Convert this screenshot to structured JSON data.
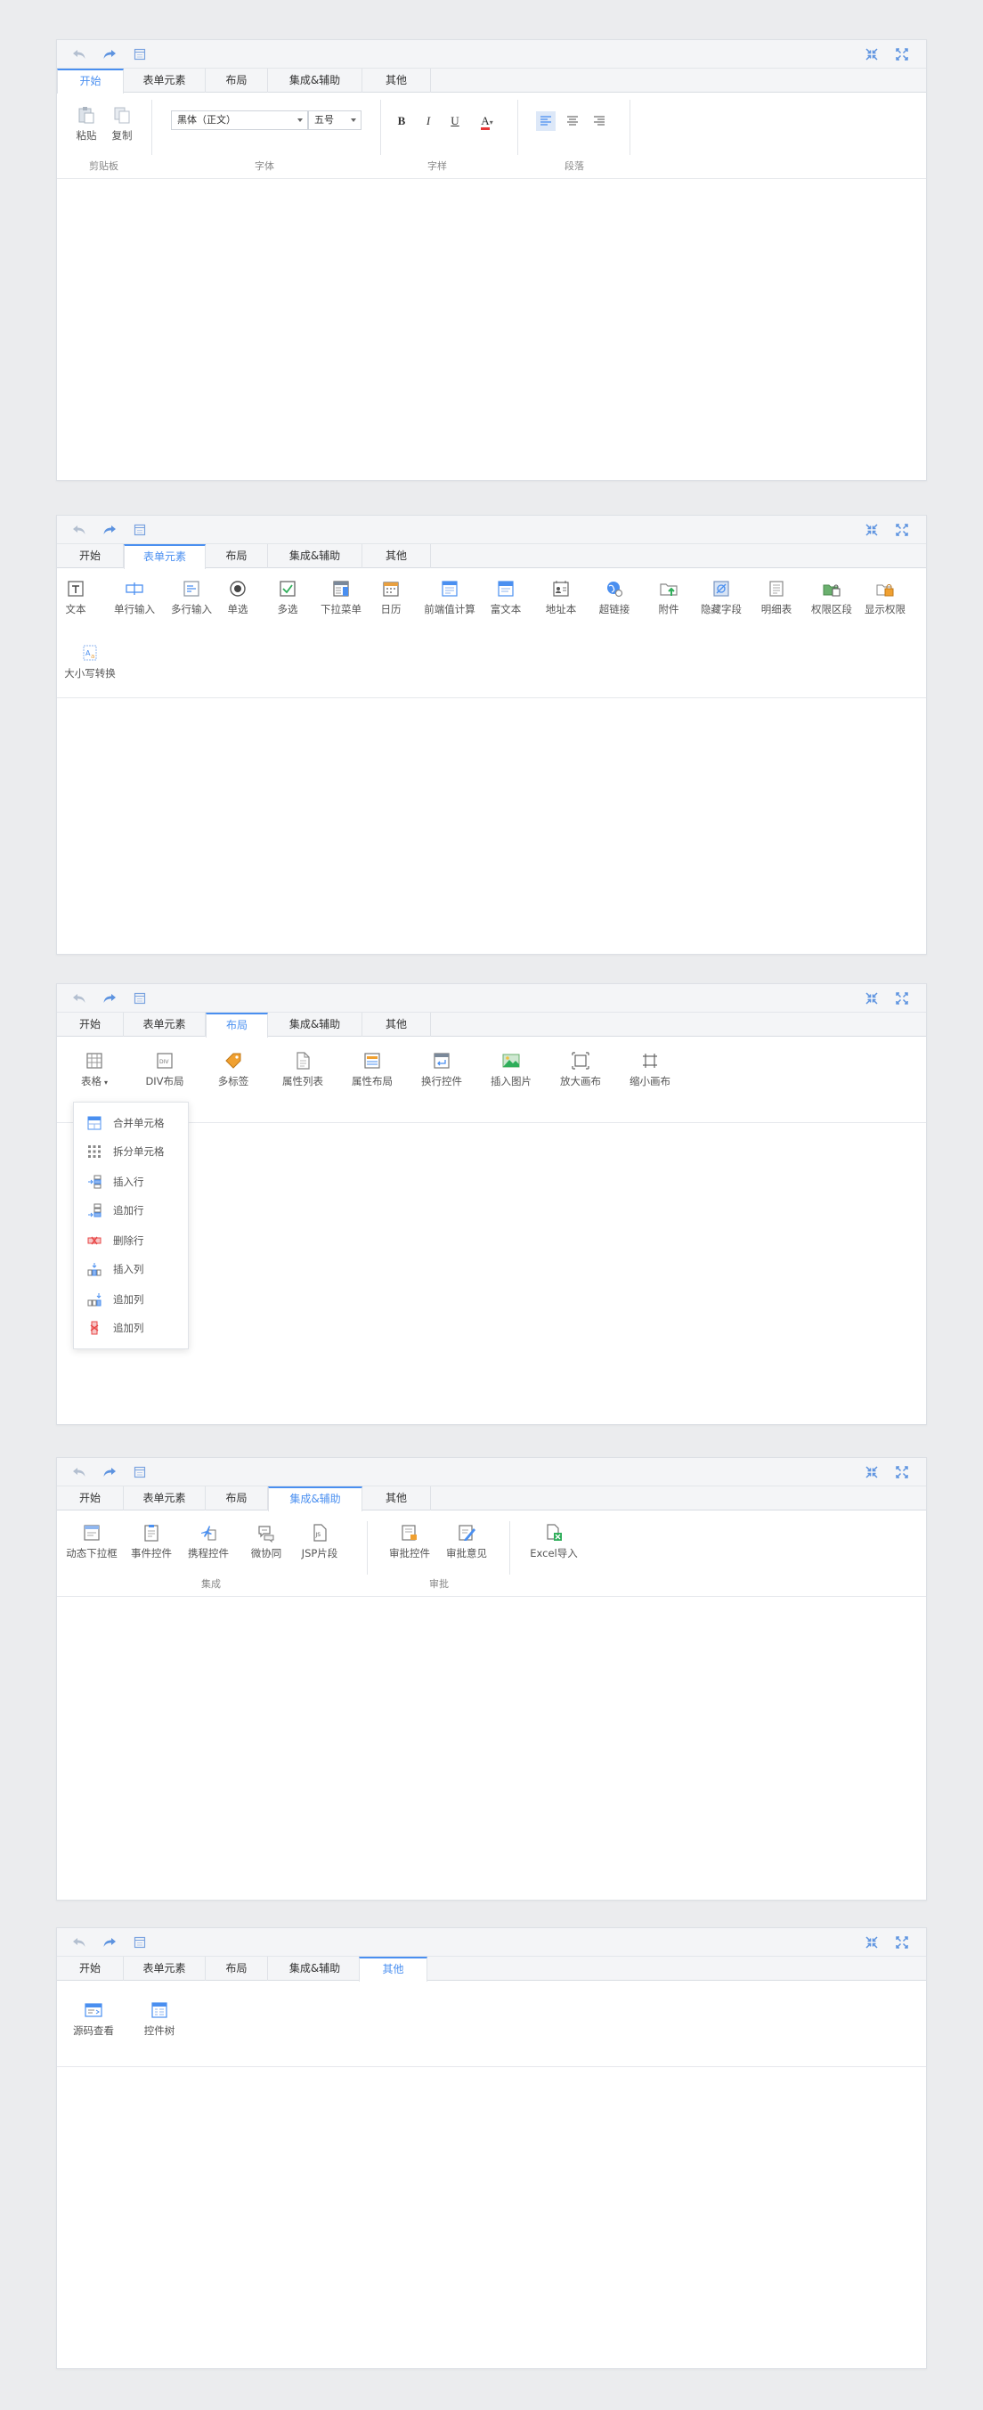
{
  "quick_access": {
    "undo_icon": "undo-arrow-icon",
    "redo_icon": "redo-arrow-icon",
    "page_icon": "page-icon",
    "collapse_icon": "collapse-arrows-icon",
    "expand_icon": "expand-arrows-icon"
  },
  "tabs": [
    "开始",
    "表单元素",
    "布局",
    "集成&辅助",
    "其他"
  ],
  "accent_color": "#4a8ff0",
  "panel_start": {
    "clipboard": {
      "paste": "粘贴",
      "copy": "复制",
      "group": "剪贴板"
    },
    "font": {
      "family": "黑体（正文）",
      "size": "五号",
      "group": "字体"
    },
    "style": {
      "bold": "B",
      "italic": "I",
      "underline": "U",
      "color": "A",
      "group": "字样"
    },
    "paragraph": {
      "group": "段落"
    }
  },
  "panel_form": {
    "items": [
      "文本",
      "单行输入",
      "多行输入",
      "单选",
      "多选",
      "下拉菜单",
      "日历",
      "前端值计算",
      "富文本",
      "地址本",
      "超链接",
      "附件",
      "隐藏字段",
      "明细表",
      "权限区段",
      "显示权限",
      "大小写转换"
    ]
  },
  "panel_layout": {
    "items": [
      "表格",
      "DIV布局",
      "多标签",
      "属性列表",
      "属性布局",
      "换行控件",
      "插入图片",
      "放大画布",
      "缩小画布"
    ],
    "dropdown": [
      "合并单元格",
      "拆分单元格",
      "插入行",
      "追加行",
      "删除行",
      "插入列",
      "追加列",
      "追加列"
    ]
  },
  "panel_integration": {
    "items": [
      "动态下拉框",
      "事件控件",
      "携程控件",
      "微协同",
      "JSP片段",
      "审批控件",
      "审批意见",
      "Excel导入"
    ],
    "group_integration": "集成",
    "group_approval": "审批"
  },
  "panel_other": {
    "items": [
      "源码查看",
      "控件树"
    ]
  }
}
